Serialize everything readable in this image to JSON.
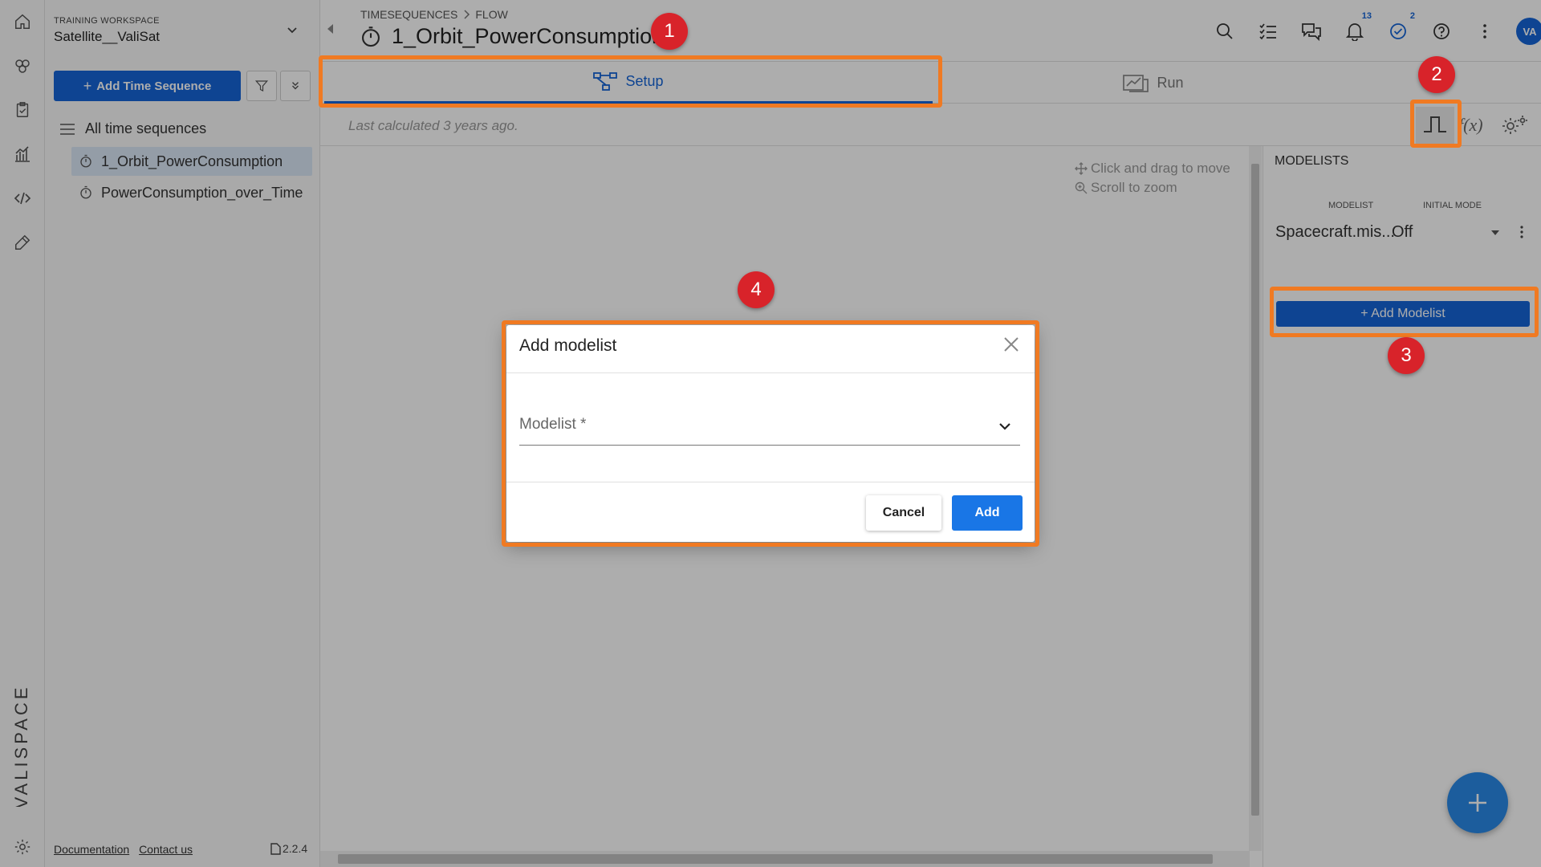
{
  "sidebar": {
    "workspace_label": "TRAINING WORKSPACE",
    "workspace_name": "Satellite__ValiSat",
    "add_button": "Add Time Sequence",
    "all_label": "All time sequences",
    "items": [
      {
        "label": "1_Orbit_PowerConsumption",
        "selected": true
      },
      {
        "label": "PowerConsumption_over_Time",
        "selected": false
      }
    ],
    "footer": {
      "documentation": "Documentation",
      "contact": "Contact us",
      "version": "2.2.4"
    }
  },
  "header": {
    "breadcrumb": [
      "TIMESEQUENCES",
      "FLOW"
    ],
    "title": "1_Orbit_PowerConsumption",
    "notifications_badge": "13",
    "tasks_badge": "2",
    "avatar": "VA"
  },
  "tabs": [
    {
      "label": "Setup",
      "active": true
    },
    {
      "label": "Run",
      "active": false
    }
  ],
  "toolbar": {
    "last_calculated": "Last calculated 3 years ago."
  },
  "canvas": {
    "hint_move": "Click and drag to move",
    "hint_zoom": "Scroll to zoom"
  },
  "right_panel": {
    "title": "MODELISTS",
    "col_modelist": "MODELIST",
    "col_initial_mode": "INITIAL MODE",
    "row": {
      "modelist": "Spacecraft.mis...",
      "mode": "Off"
    },
    "add_button": "+ Add Modelist"
  },
  "dialog": {
    "title": "Add modelist",
    "field_label": "Modelist *",
    "cancel": "Cancel",
    "add": "Add"
  },
  "markers": [
    "1",
    "2",
    "3",
    "4"
  ],
  "brand": {
    "logo_text": "VALISPACE",
    "primary": "#1565d8",
    "highlight": "#f07a22",
    "marker": "#d8232a"
  }
}
